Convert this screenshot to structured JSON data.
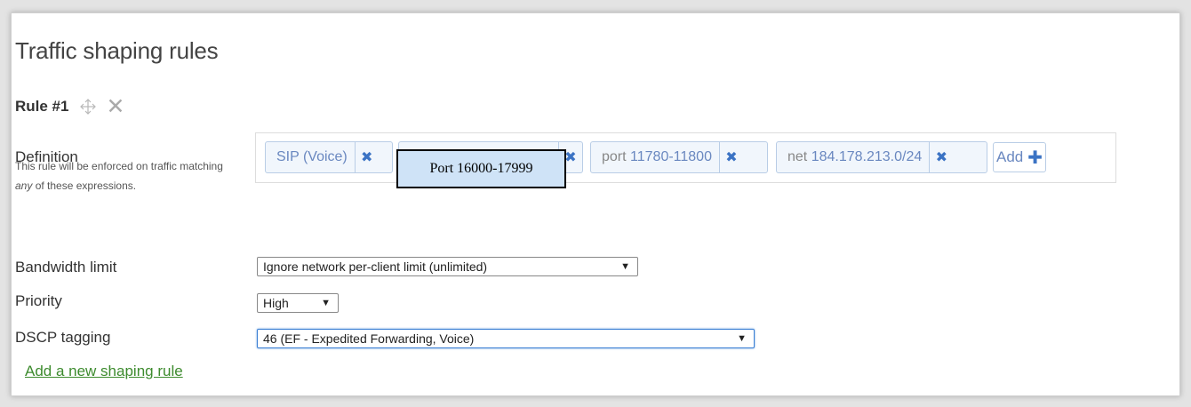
{
  "page": {
    "title": "Traffic shaping rules"
  },
  "rule": {
    "title": "Rule #1",
    "definition": {
      "label": "Definition",
      "help_before": "This rule will be enforced on traffic matching ",
      "help_emphasis": "any",
      "help_after": " of these expressions.",
      "chips": [
        {
          "text": "SIP (Voice)"
        },
        {
          "text": ""
        },
        {
          "keyword": "port",
          "value": "11780-11800"
        },
        {
          "keyword": "net",
          "value": "184.178.213.0/24"
        }
      ],
      "remove_glyph": "✖",
      "add_label": "Add",
      "add_glyph": "✚",
      "overlay_text": "Port 16000-17999"
    },
    "bandwidth": {
      "label": "Bandwidth limit",
      "value": "Ignore network per-client limit (unlimited)"
    },
    "priority": {
      "label": "Priority",
      "value": "High"
    },
    "dscp": {
      "label": "DSCP tagging",
      "value": "46 (EF - Expedited Forwarding, Voice)"
    },
    "close_glyph": "✕",
    "dropdown_arrow": "▼"
  },
  "actions": {
    "add_rule_label": "Add a new shaping rule"
  },
  "icons": {
    "move": "move-arrows-icon",
    "close": "close-icon",
    "remove": "remove-x-icon",
    "plus": "plus-icon",
    "dropdown": "chevron-down-icon"
  },
  "colors": {
    "chip_bg": "#f1f6fc",
    "chip_border": "#b9cde6",
    "chip_text": "#6a88c0",
    "remove_x": "#3b73c4",
    "link": "#3d8b2e",
    "overlay_bg": "#cfe3f7"
  }
}
